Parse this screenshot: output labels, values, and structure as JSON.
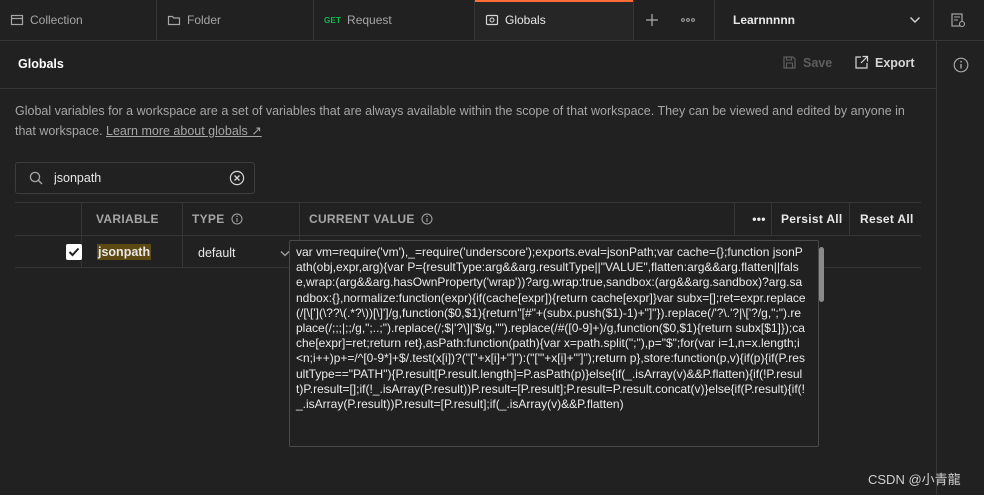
{
  "tabs": [
    {
      "label": "Collection",
      "icon": "collection-icon"
    },
    {
      "label": "Folder",
      "icon": "folder-icon"
    },
    {
      "method": "GET",
      "label": "Request"
    },
    {
      "label": "Globals",
      "icon": "globals-icon",
      "active": true
    }
  ],
  "workspace_name": "Learnnnnn",
  "header": {
    "title": "Globals",
    "save_label": "Save",
    "export_label": "Export"
  },
  "description": {
    "text": "Global variables for a workspace are a set of variables that are always available within the scope of that workspace. They can be viewed and edited by anyone in that workspace.",
    "link": "Learn more about globals ↗"
  },
  "search": {
    "value": "jsonpath"
  },
  "table": {
    "columns": {
      "variable": "VARIABLE",
      "type": "TYPE",
      "current_value": "CURRENT VALUE"
    },
    "actions": {
      "more": "•••",
      "persist_all": "Persist All",
      "reset_all": "Reset All"
    },
    "rows": [
      {
        "enabled": true,
        "variable": "jsonpath",
        "type": "default",
        "current_value": "var vm=require('vm'),_=require('underscore');exports.eval=jsonPath;var cache={};function jsonPath(obj,expr,arg){var P={resultType:arg&&arg.resultType||\"VALUE\",flatten:arg&&arg.flatten||false,wrap:(arg&&arg.hasOwnProperty('wrap'))?arg.wrap:true,sandbox:(arg&&arg.sandbox)?arg.sandbox:{},normalize:function(expr){if(cache[expr]){return cache[expr]}var subx=[];ret=expr.replace(/[\\['](\\??\\(.*?\\))[\\]']/g,function($0,$1){return\"[#\"+(subx.push($1)-1)+\"]\"}).replace(/'?\\.'?|\\['?/g,\";\").replace(/;;;|;;/g,\";..;\").replace(/;$|'?\\]|'$/g,\"\").replace(/#([0-9]+)/g,function($0,$1){return subx[$1]});cache[expr]=ret;return ret},asPath:function(path){var x=path.split(\";\"),p=\"$\";for(var i=1,n=x.length;i<n;i++)p+=/^[0-9*]+$/.test(x[i])?(\"[\"+x[i]+\"]\"):(\"['\"+x[i]+\"']\");return p},store:function(p,v){if(p){if(P.resultType==\"PATH\"){P.result[P.result.length]=P.asPath(p)}else{if(_.isArray(v)&&P.flatten){if(!P.result)P.result=[];if(!_.isArray(P.result))P.result=[P.result];P.result=P.result.concat(v)}else{if(P.result){if(!_.isArray(P.result))P.result=[P.result];if(_.isArray(v)&&P.flatten)"
      }
    ]
  },
  "watermark": "CSDN @小青龍",
  "colors": {
    "background": "#212121",
    "accent": "#ff6c37",
    "get_method": "#0cbb52",
    "search_highlight": "#5c4a12"
  }
}
